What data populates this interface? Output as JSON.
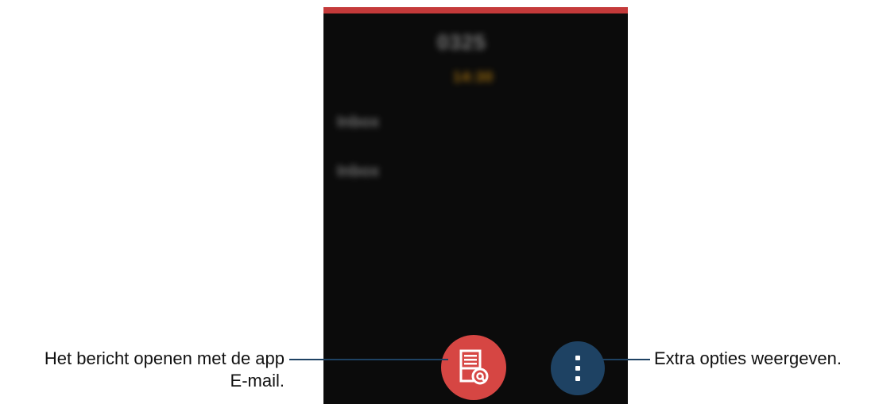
{
  "screen": {
    "accent_color": "#c43a3a",
    "title_blurred": "0325",
    "time_blurred": "14:30",
    "rows_blurred": [
      "Inbox",
      "Inbox"
    ]
  },
  "actions": {
    "email_button": {
      "icon": "email-app-icon",
      "color": "#d64643"
    },
    "more_button": {
      "icon": "more-options-icon",
      "color": "#1e4263"
    }
  },
  "callouts": {
    "left_line1": "Het bericht openen met de app",
    "left_line2": "E-mail.",
    "right": "Extra opties weergeven."
  }
}
